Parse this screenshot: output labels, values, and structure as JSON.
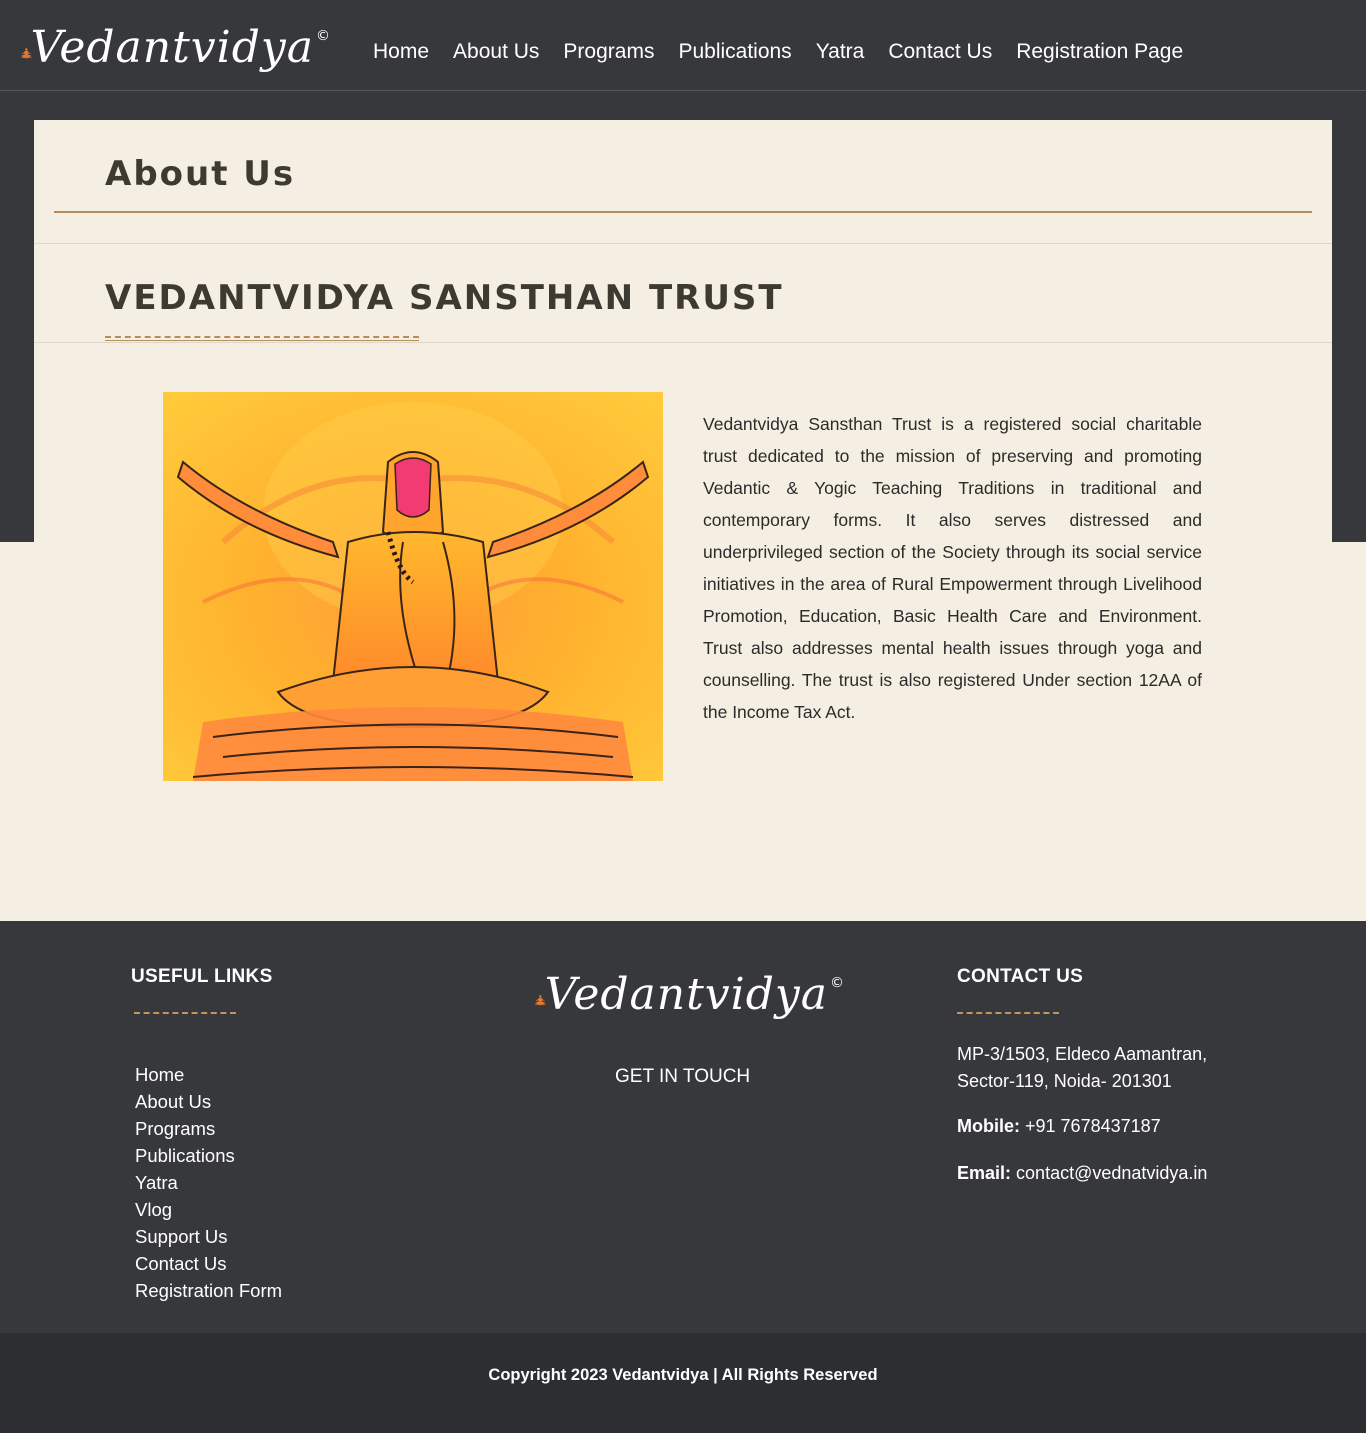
{
  "brand": {
    "name": "Vedantvidya",
    "mark": "©",
    "logo_icon": "meditating-figure-icon",
    "accent_color": "#e8782e"
  },
  "nav": {
    "items": [
      "Home",
      "About Us",
      "Programs",
      "Publications",
      "Yatra",
      "Contact Us",
      "Registration Page"
    ]
  },
  "page": {
    "title": "About Us",
    "section_title": "VEDANTVIDYA SANSTHAN TRUST",
    "description": "Vedantvidya Sansthan Trust is a registered social charitable trust dedicated to the mission of preserving and promoting Vedantic & Yogic Teaching Traditions in traditional and contemporary forms. It also serves distressed and underprivileged section of the Society through its social service initiatives in the area of Rural Empowerment through Livelihood Promotion, Education, Basic Health Care and Environment. Trust also addresses mental health issues through yoga and counselling. The trust is also registered Under section 12AA of the Income Tax Act."
  },
  "footer": {
    "useful_links_heading": "USEFUL LINKS",
    "links": [
      "Home",
      "About Us",
      "Programs",
      "Publications",
      "Yatra",
      "Vlog",
      "Support Us",
      "Contact Us",
      "Registration Form"
    ],
    "get_in_touch": "GET IN TOUCH",
    "contact_heading": "CONTACT US",
    "address_line1": "MP-3/1503, Eldeco Aamantran,",
    "address_line2": "Sector-119, Noida- 201301",
    "mobile_label": "Mobile:",
    "mobile_value": "+91 7678437187",
    "email_label": "Email:",
    "email_value": "contact@vednatvidya.in"
  },
  "copyright": "Copyright 2023 Vedantvidya | All Rights Reserved",
  "colors": {
    "dark_bg": "#37383b",
    "cream_bg": "#f5efe3",
    "gold_rule": "#b58d5c"
  }
}
